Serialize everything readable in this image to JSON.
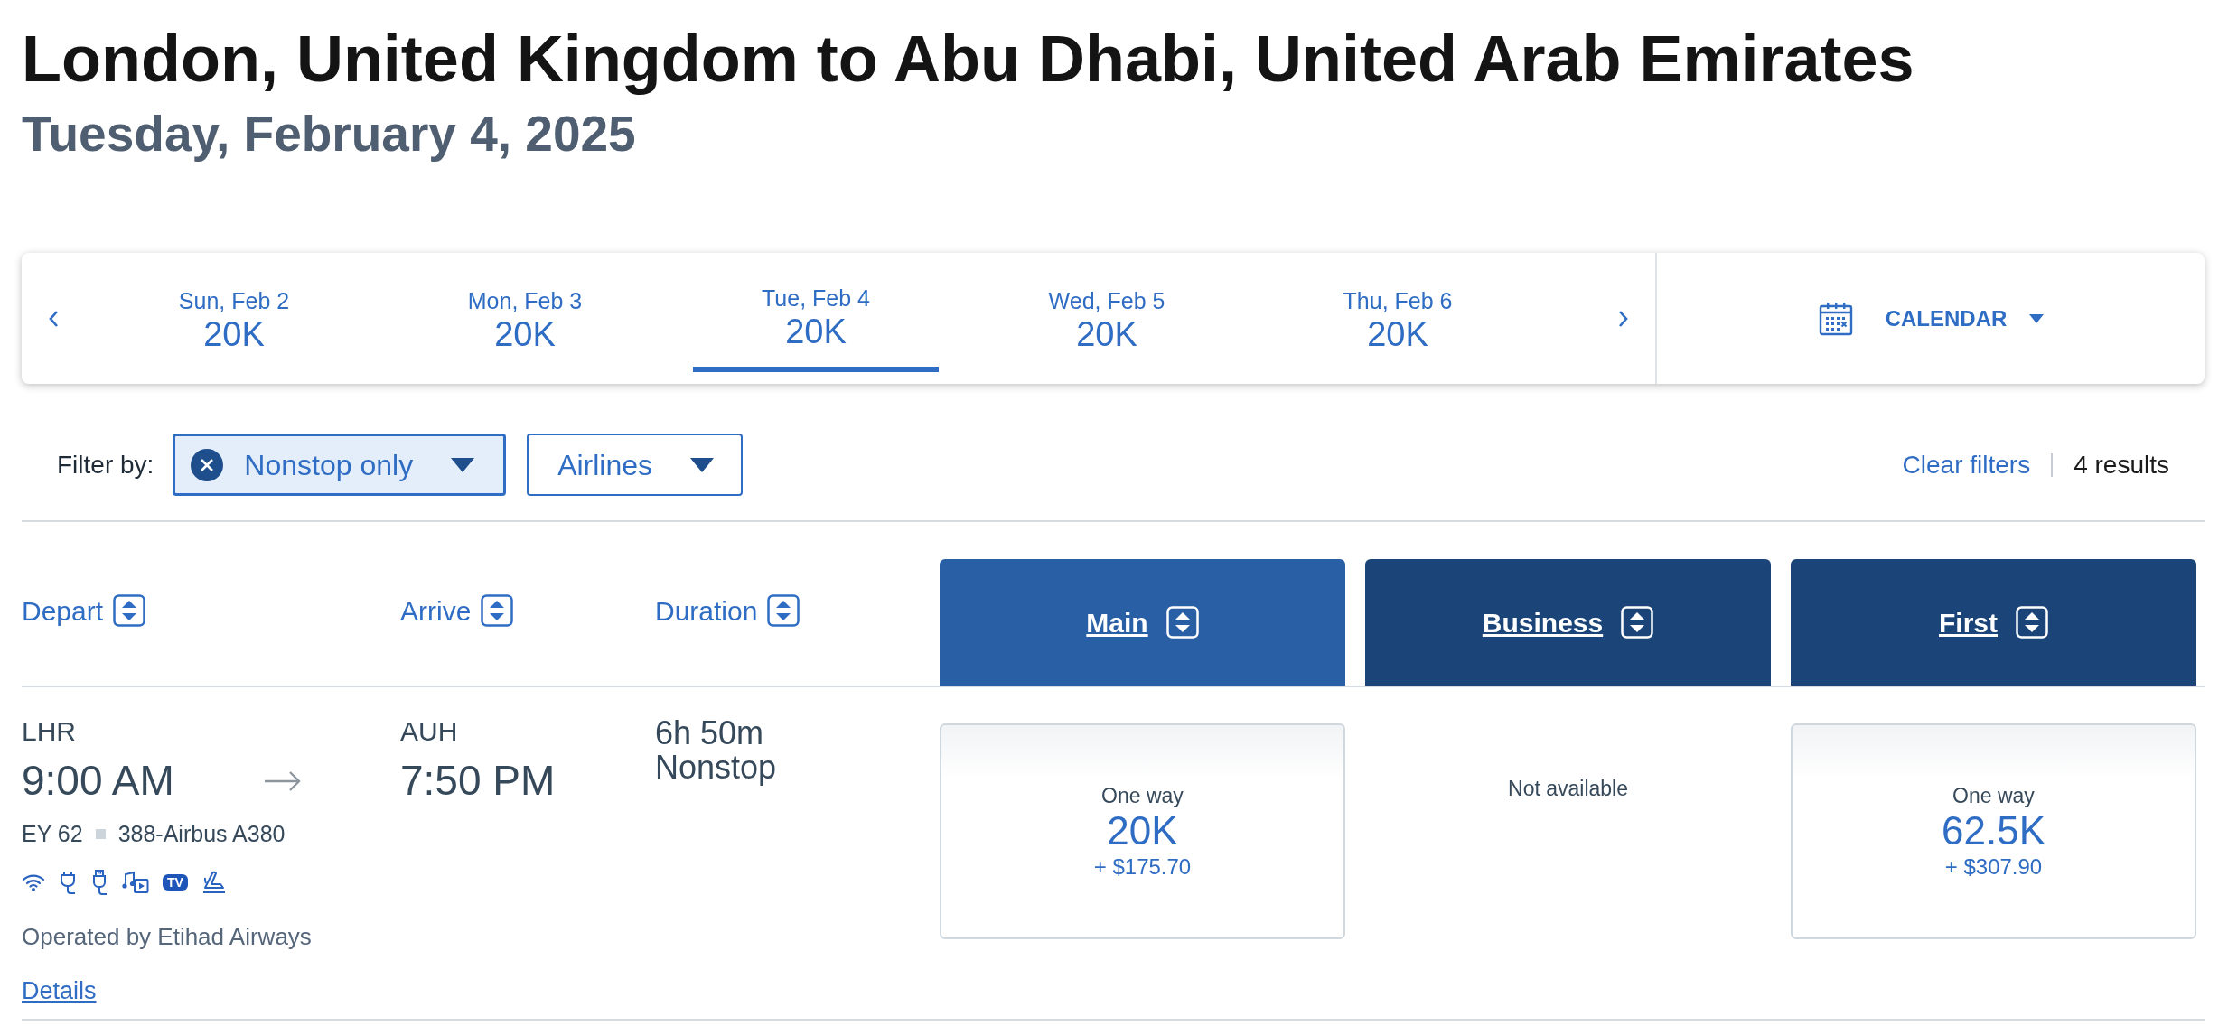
{
  "header": {
    "title": "London, United Kingdom to Abu Dhabi, United Arab Emirates",
    "date": "Tuesday, February 4, 2025"
  },
  "date_strip": {
    "dates": [
      {
        "day": "Sun, Feb 2",
        "price": "20K",
        "selected": false
      },
      {
        "day": "Mon, Feb 3",
        "price": "20K",
        "selected": false
      },
      {
        "day": "Tue, Feb 4",
        "price": "20K",
        "selected": true
      },
      {
        "day": "Wed, Feb 5",
        "price": "20K",
        "selected": false
      },
      {
        "day": "Thu, Feb 6",
        "price": "20K",
        "selected": false
      }
    ],
    "calendar_button": "CALENDAR"
  },
  "filters": {
    "label": "Filter by:",
    "dropdowns": [
      {
        "label": "Nonstop only",
        "active": true
      },
      {
        "label": "Airlines",
        "active": false
      }
    ],
    "clear_link": "Clear filters",
    "result_count": "4 results"
  },
  "columns": [
    {
      "label": "Depart",
      "kind": "sort"
    },
    {
      "label": "Arrive",
      "kind": "sort"
    },
    {
      "label": "Duration",
      "kind": "sort"
    },
    {
      "label": "Main",
      "kind": "cabin",
      "color": "#285fa5"
    },
    {
      "label": "Business",
      "kind": "cabin",
      "color": "#1b4478"
    },
    {
      "label": "First",
      "kind": "cabin",
      "color": "#1b4478"
    }
  ],
  "flights": [
    {
      "depart_airport": "LHR",
      "depart_time": "9:00 AM",
      "arrive_airport": "AUH",
      "arrive_time": "7:50 PM",
      "duration": "6h 50m",
      "stops": "Nonstop",
      "flight_number": "EY 62",
      "aircraft": "388-Airbus A380",
      "amenities": [
        {
          "kind": "wifi"
        },
        {
          "kind": "power"
        },
        {
          "kind": "usb"
        },
        {
          "kind": "media"
        },
        {
          "kind": "tv",
          "label": "TV"
        },
        {
          "kind": "seat"
        }
      ],
      "operator": "Operated by Etihad Airways",
      "details_link": "Details",
      "fares": [
        {
          "kind": "fare",
          "label": "One way",
          "miles": "20K",
          "taxes": "+ $175.70"
        },
        {
          "kind": "unavailable",
          "label": "Not available"
        },
        {
          "kind": "fare",
          "label": "One way",
          "miles": "62.5K",
          "taxes": "+ $307.90"
        }
      ]
    }
  ]
}
